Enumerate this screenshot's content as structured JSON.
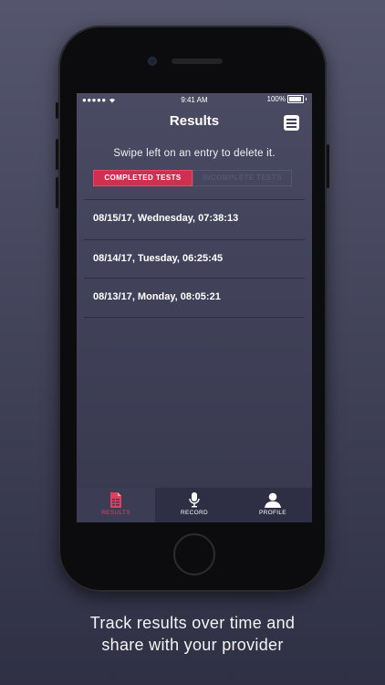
{
  "status_bar": {
    "signal": "●●●●●",
    "time": "9:41 AM",
    "battery_pct": "100%"
  },
  "header": {
    "title": "Results",
    "menu_icon": "hamburger-menu-icon"
  },
  "hint": "Swipe left on an entry to delete it.",
  "segments": {
    "completed": "COMPLETED TESTS",
    "incomplete": "INCOMPLETE TESTS"
  },
  "results": [
    "08/15/17, Wednesday, 07:38:13",
    "08/14/17, Tuesday, 06:25:45",
    "08/13/17, Monday, 08:05:21"
  ],
  "tabs": [
    {
      "label": "RESULTS",
      "icon": "document-icon",
      "active": true
    },
    {
      "label": "RECORD",
      "icon": "microphone-icon",
      "active": false
    },
    {
      "label": "PROFILE",
      "icon": "person-icon",
      "active": false
    }
  ],
  "colors": {
    "accent": "#d0304f",
    "screen_bg": "#42435a",
    "tabbar_bg": "#2e2f45"
  },
  "caption": {
    "line1": "Track results over time and",
    "line2": "share with your provider"
  }
}
